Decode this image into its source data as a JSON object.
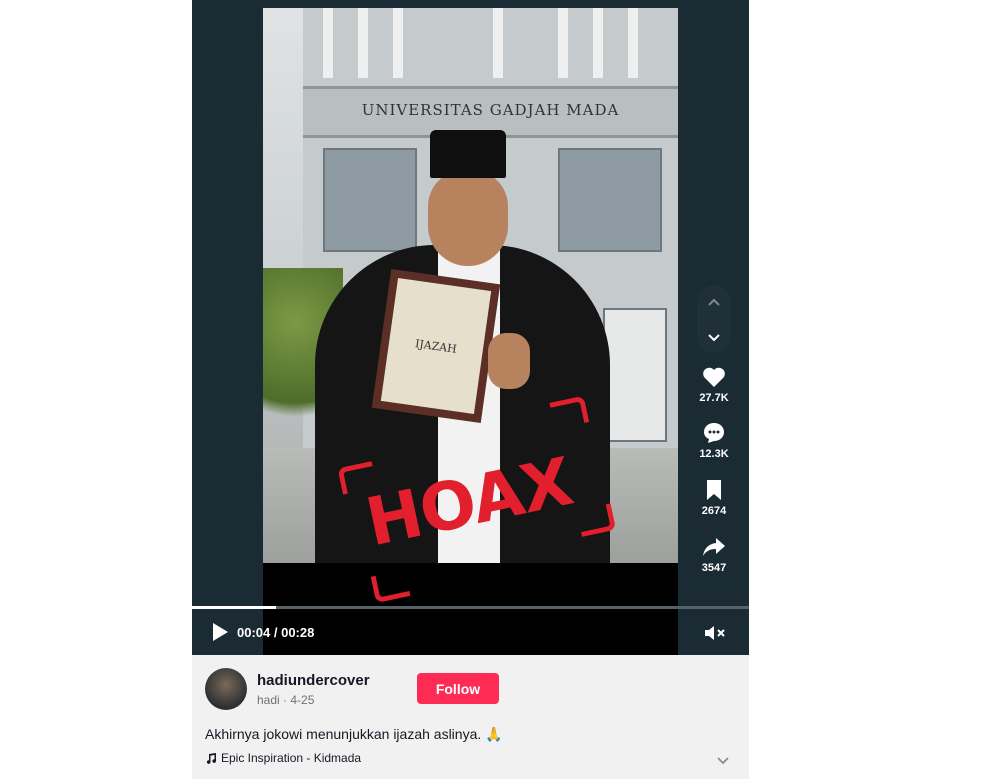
{
  "video": {
    "sign_text": "UNIVERSITAS GADJAH MADA",
    "diploma_text": "IJAZAH",
    "overlay_stamp": "HOAX",
    "stamp_color": "#e21f2c"
  },
  "nav": {
    "up_icon": "chevron-up-icon",
    "down_icon": "chevron-down-icon"
  },
  "actions": {
    "likes": "27.7K",
    "comments": "12.3K",
    "saves": "2674",
    "shares": "3547"
  },
  "controls": {
    "time": "00:04 / 00:28",
    "progress": 0.15
  },
  "post": {
    "username": "hadiundercover",
    "subline": "hadi · 4-25",
    "follow_label": "Follow",
    "caption": "Akhirnya jokowi menunjukkan ijazah aslinya. 🙏",
    "music": "Epic Inspiration - Kidmada",
    "accent": "#fe2c55"
  }
}
